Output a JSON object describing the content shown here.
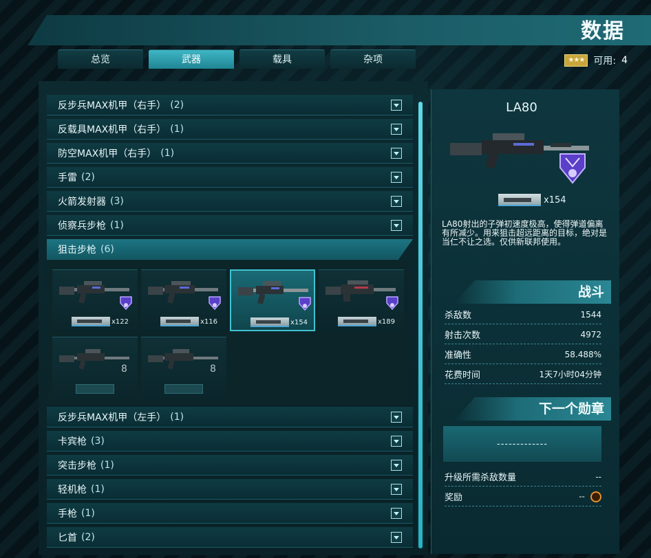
{
  "header": {
    "title": "数据"
  },
  "tabs": [
    {
      "label": "总览"
    },
    {
      "label": "武器"
    },
    {
      "label": "载具"
    },
    {
      "label": "杂项"
    }
  ],
  "active_tab": "武器",
  "available": {
    "icon": "three-stars-icon",
    "label": "可用:",
    "count": "4"
  },
  "categories_top": [
    {
      "label": "反步兵MAX机甲（右手）",
      "count": "(2)"
    },
    {
      "label": "反载具MAX机甲（右手）",
      "count": "(1)"
    },
    {
      "label": "防空MAX机甲（右手）",
      "count": "(1)"
    },
    {
      "label": "手雷",
      "count": "(2)"
    },
    {
      "label": "火箭发射器",
      "count": "(3)"
    },
    {
      "label": "侦察兵步枪",
      "count": "(1)"
    }
  ],
  "open_category": {
    "label": "狙击步枪",
    "count": "(6)"
  },
  "weapons": [
    {
      "ammo": "x122",
      "medal": "purple-medal-icon",
      "selected": false
    },
    {
      "ammo": "x116",
      "medal": "purple-medal-icon",
      "selected": false
    },
    {
      "ammo": "x154",
      "medal": "purple-medal-icon",
      "selected": true
    },
    {
      "ammo": "x189",
      "medal": "purple-medal-icon",
      "selected": false
    },
    {
      "ammo": "",
      "medal": "empty-medal-icon",
      "selected": false
    },
    {
      "ammo": "",
      "medal": "empty-medal-icon",
      "selected": false
    }
  ],
  "categories_bottom": [
    {
      "label": "反步兵MAX机甲（左手）",
      "count": "(1)"
    },
    {
      "label": "卡宾枪",
      "count": "(3)"
    },
    {
      "label": "突击步枪",
      "count": "(1)"
    },
    {
      "label": "轻机枪",
      "count": "(1)"
    },
    {
      "label": "手枪",
      "count": "(1)"
    },
    {
      "label": "匕首",
      "count": "(2)"
    }
  ],
  "detail": {
    "name": "LA80",
    "ammo_count": "x154",
    "description": "LA80射出的子弹初速度极高，使得弹道偏离有所减少。用来狙击超远距离的目标，绝对是当仁不让之选。仅供新联邦使用。"
  },
  "combat": {
    "title": "战斗",
    "rows": [
      {
        "label": "杀敌数",
        "value": "1544"
      },
      {
        "label": "射击次数",
        "value": "4972"
      },
      {
        "label": "准确性",
        "value": "58.488%"
      },
      {
        "label": "花费时间",
        "value": "1天7小时04分钟"
      }
    ]
  },
  "next_medal": {
    "title": "下一个勋章",
    "box_text": "-------------",
    "rows": [
      {
        "label": "升级所需杀敌数量",
        "value": "--"
      },
      {
        "label": "奖励",
        "value": "--"
      }
    ]
  },
  "colors": {
    "accent": "#2ab1c2",
    "medal": "#8f6cff",
    "reward": "#e7922f"
  }
}
